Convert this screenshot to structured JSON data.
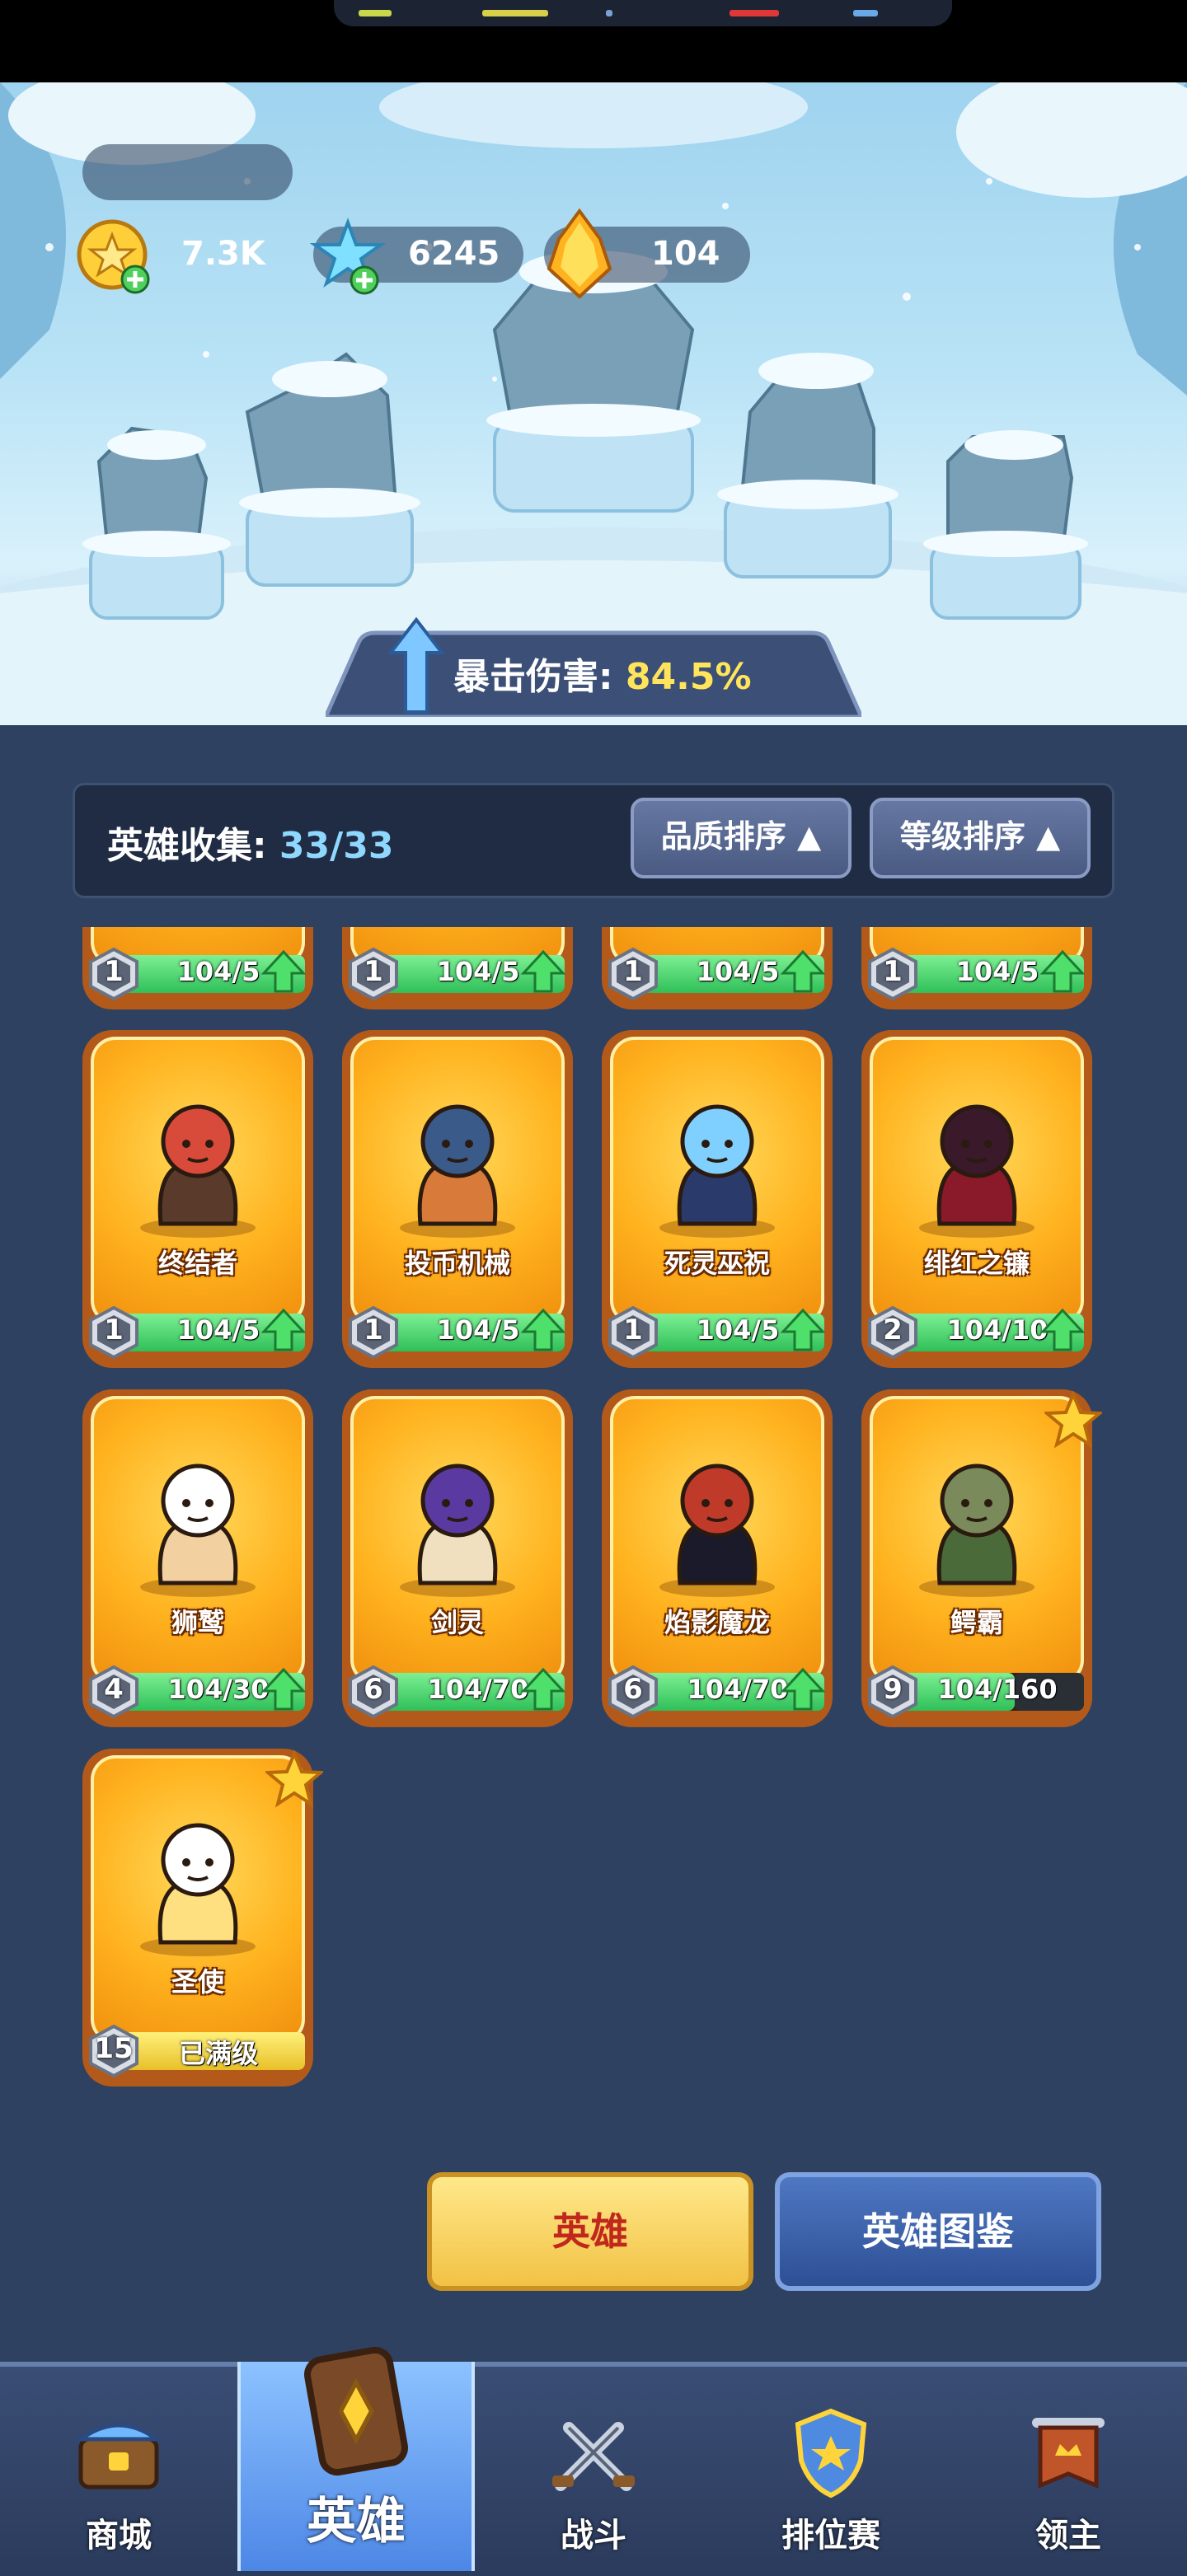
{
  "currencies": [
    {
      "icon": "gold-coin-icon",
      "value": "7.3K"
    },
    {
      "icon": "crystal-icon",
      "value": "6245"
    },
    {
      "icon": "flame-crystal-icon",
      "value": "104"
    }
  ],
  "buff": {
    "label": "暴击伤害: ",
    "value": "84.5%"
  },
  "collection": {
    "label": "英雄收集: ",
    "value": "33/33"
  },
  "sort": {
    "quality": "品质排序",
    "level": "等级排序"
  },
  "top_partial_row": [
    {
      "level": "1",
      "progress": "104/5"
    },
    {
      "level": "1",
      "progress": "104/5"
    },
    {
      "level": "1",
      "progress": "104/5"
    },
    {
      "level": "1",
      "progress": "104/5"
    }
  ],
  "heroes": [
    {
      "name": "终结者",
      "level": "1",
      "progress": "104/5",
      "fill": 1.0,
      "upgradable": true,
      "star": false
    },
    {
      "name": "投币机械",
      "level": "1",
      "progress": "104/5",
      "fill": 1.0,
      "upgradable": true,
      "star": false
    },
    {
      "name": "死灵巫祝",
      "level": "1",
      "progress": "104/5",
      "fill": 1.0,
      "upgradable": true,
      "star": false
    },
    {
      "name": "绯红之镰",
      "level": "2",
      "progress": "104/10",
      "fill": 1.0,
      "upgradable": true,
      "star": false
    },
    {
      "name": "狮鹫",
      "level": "4",
      "progress": "104/30",
      "fill": 1.0,
      "upgradable": true,
      "star": false
    },
    {
      "name": "剑灵",
      "level": "6",
      "progress": "104/70",
      "fill": 1.0,
      "upgradable": true,
      "star": false
    },
    {
      "name": "焰影魔龙",
      "level": "6",
      "progress": "104/70",
      "fill": 1.0,
      "upgradable": true,
      "star": false
    },
    {
      "name": "鳄霸",
      "level": "9",
      "progress": "104/160",
      "fill": 0.65,
      "upgradable": false,
      "star": true
    },
    {
      "name": "圣使",
      "level": "15",
      "progress": "已满级",
      "fill": 1.0,
      "upgradable": false,
      "star": true,
      "maxed": true
    }
  ],
  "buttons": {
    "hero": "英雄",
    "codex": "英雄图鉴"
  },
  "nav": [
    {
      "label": "商城",
      "icon": "shop-chest-icon"
    },
    {
      "label": "英雄",
      "icon": "hero-card-icon",
      "active": true
    },
    {
      "label": "战斗",
      "icon": "crossed-swords-icon"
    },
    {
      "label": "排位赛",
      "icon": "rank-shield-icon"
    },
    {
      "label": "领主",
      "icon": "lord-banner-icon"
    }
  ],
  "colors": {
    "accent_green": "#2fbf59",
    "card_gold": "#ffb21e",
    "buff_value": "#ffe45c",
    "collection_value": "#8fd7ff"
  }
}
